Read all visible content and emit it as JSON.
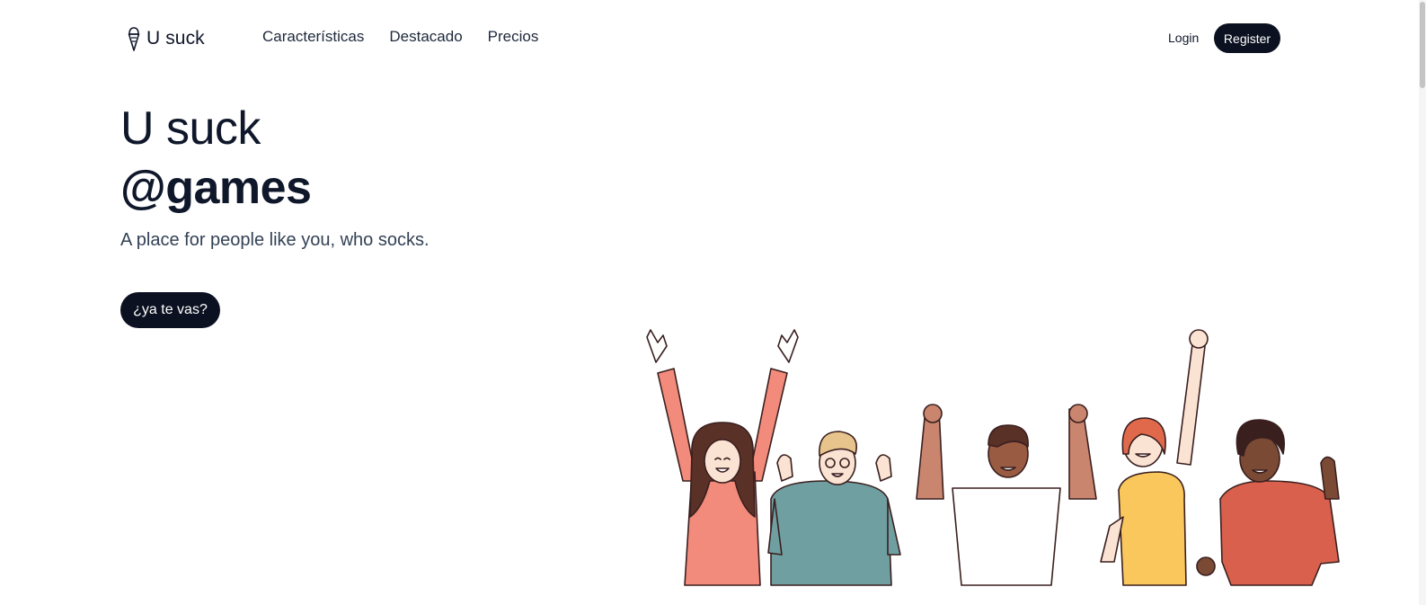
{
  "brand": {
    "name": "U suck",
    "icon": "ice-cream-cone-icon"
  },
  "nav": {
    "items": [
      {
        "label": "Características"
      },
      {
        "label": "Destacado"
      },
      {
        "label": "Precios"
      }
    ]
  },
  "auth": {
    "login_label": "Login",
    "register_label": "Register"
  },
  "hero": {
    "title": "U suck",
    "subtitle": "@games",
    "description": "A place for people like you, who socks.",
    "cta_label": "¿ya te vas?"
  },
  "illustration": {
    "name": "cheering-people-illustration"
  },
  "colors": {
    "primary": "#0b1120",
    "text": "#0f172a",
    "muted": "#334155"
  }
}
